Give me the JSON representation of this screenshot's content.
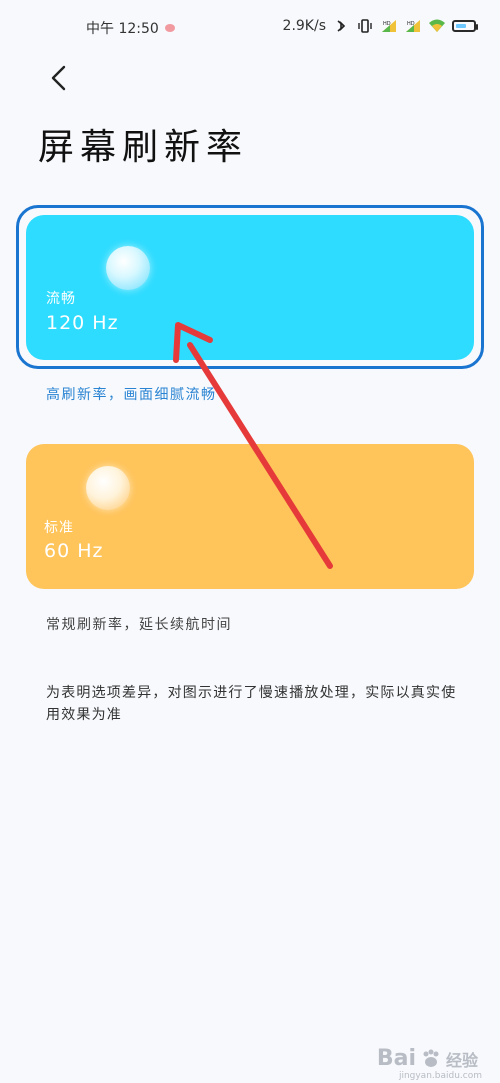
{
  "status_bar": {
    "time": "中午 12:50",
    "network_speed": "2.9K/s",
    "icons": [
      "bluetooth-icon",
      "vibrate-icon",
      "signal-hd-icon",
      "signal-hd-icon",
      "wifi-icon",
      "battery-icon"
    ]
  },
  "header": {
    "back_icon": "chevron-left-icon",
    "title": "屏幕刷新率"
  },
  "options": [
    {
      "label": "流畅",
      "rate": "120 Hz",
      "description": "高刷新率，画面细腻流畅",
      "selected": true,
      "color": "#2edcff"
    },
    {
      "label": "标准",
      "rate": "60 Hz",
      "description": "常规刷新率，延长续航时间",
      "selected": false,
      "color": "#ffc45a"
    }
  ],
  "footnote": "为表明选项差异，对图示进行了慢速播放处理，实际以真实使用效果为准",
  "watermark": {
    "text": "Bai",
    "suffix": "经验",
    "url": "jingyan.baidu.com"
  },
  "colors": {
    "accent": "#1a75d1",
    "arrow": "#e63a3a"
  }
}
